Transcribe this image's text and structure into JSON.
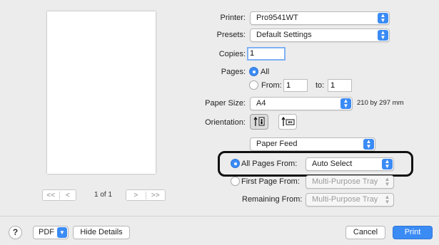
{
  "preview": {
    "page_indicator": "1 of 1",
    "first_label": "<<",
    "prev_label": "<",
    "next_label": ">",
    "last_label": ">>"
  },
  "printer": {
    "label": "Printer:",
    "value": "Pro9541WT"
  },
  "presets": {
    "label": "Presets:",
    "value": "Default Settings"
  },
  "copies": {
    "label": "Copies:",
    "value": "1"
  },
  "pages": {
    "label": "Pages:",
    "all_label": "All",
    "from_label": "From:",
    "from_value": "1",
    "to_label": "to:",
    "to_value": "1",
    "selected": "all"
  },
  "paper_size": {
    "label": "Paper Size:",
    "value": "A4",
    "dimensions": "210 by 297 mm"
  },
  "orientation": {
    "label": "Orientation:",
    "selected": "portrait"
  },
  "section_popup": {
    "value": "Paper Feed"
  },
  "paper_feed": {
    "all_pages_from_label": "All Pages From:",
    "all_pages_from_value": "Auto Select",
    "first_page_from_label": "First Page From:",
    "first_page_from_value": "Multi-Purpose Tray",
    "remaining_from_label": "Remaining From:",
    "remaining_from_value": "Multi-Purpose Tray",
    "selected": "all_pages"
  },
  "footer": {
    "help_label": "?",
    "pdf_label": "PDF",
    "hide_details_label": "Hide Details",
    "cancel_label": "Cancel",
    "print_label": "Print"
  },
  "colors": {
    "accent": "#3b8bf5",
    "highlight_border": "#111111"
  }
}
